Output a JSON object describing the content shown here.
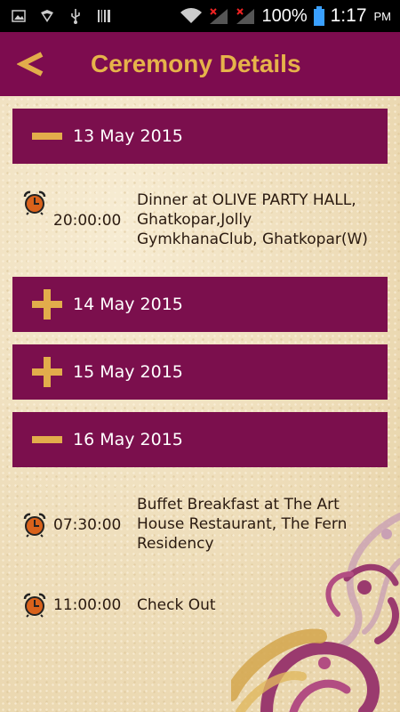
{
  "status_bar": {
    "battery": "100%",
    "time": "1:17",
    "ampm": "PM"
  },
  "header": {
    "title": "Ceremony Details",
    "back_icon": "back-chevron-icon"
  },
  "days": [
    {
      "date": "13 May 2015",
      "expanded": true,
      "events": [
        {
          "time": "20:00:00",
          "description": "Dinner at OLIVE PARTY HALL, Ghatkopar,Jolly GymkhanaClub, Ghatkopar(W)"
        }
      ]
    },
    {
      "date": "14 May 2015",
      "expanded": false,
      "events": []
    },
    {
      "date": "15 May 2015",
      "expanded": false,
      "events": []
    },
    {
      "date": "16 May 2015",
      "expanded": true,
      "events": [
        {
          "time": "07:30:00",
          "description": "Buffet Breakfast at The Art House Restaurant, The Fern Residency"
        },
        {
          "time": "11:00:00",
          "description": "Check Out"
        }
      ]
    }
  ],
  "colors": {
    "primary": "#7b0f4d",
    "accent": "#e2ad4b",
    "clock": "#d9621b"
  }
}
